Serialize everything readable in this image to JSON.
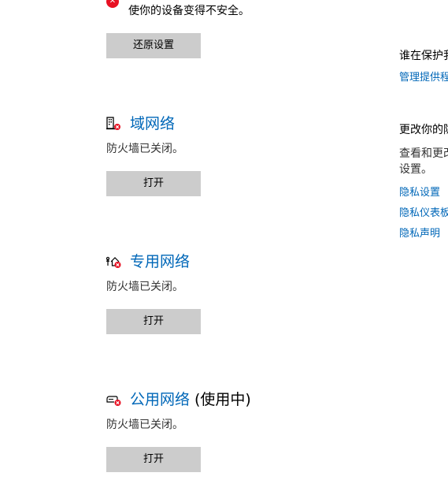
{
  "warning": {
    "text": "使你的设备变得不安全。",
    "icon": "error-icon"
  },
  "restore_button": "还原设置",
  "sections": [
    {
      "title": "域网络",
      "suffix": "",
      "icon": "domain-network-icon",
      "status": "防火墙已关闭。",
      "button": "打开"
    },
    {
      "title": "专用网络",
      "suffix": "",
      "icon": "private-network-icon",
      "status": "防火墙已关闭。",
      "button": "打开"
    },
    {
      "title": "公用网络",
      "suffix": "(使用中)",
      "icon": "public-network-icon",
      "status": "防火墙已关闭。",
      "button": "打开"
    }
  ],
  "right": {
    "who_heading": "谁在保护我",
    "manage_link": "管理提供程序",
    "change_heading": "更改你的隐私设置",
    "view_text_1": "查看和更改",
    "view_text_2": "设置。",
    "privacy_settings_link": "隐私设置",
    "privacy_dashboard_link": "隐私仪表板",
    "privacy_statement_link": "隐私声明"
  },
  "colors": {
    "link": "#0067b8",
    "button_bg": "#cccccc",
    "error_red": "#e81123"
  }
}
